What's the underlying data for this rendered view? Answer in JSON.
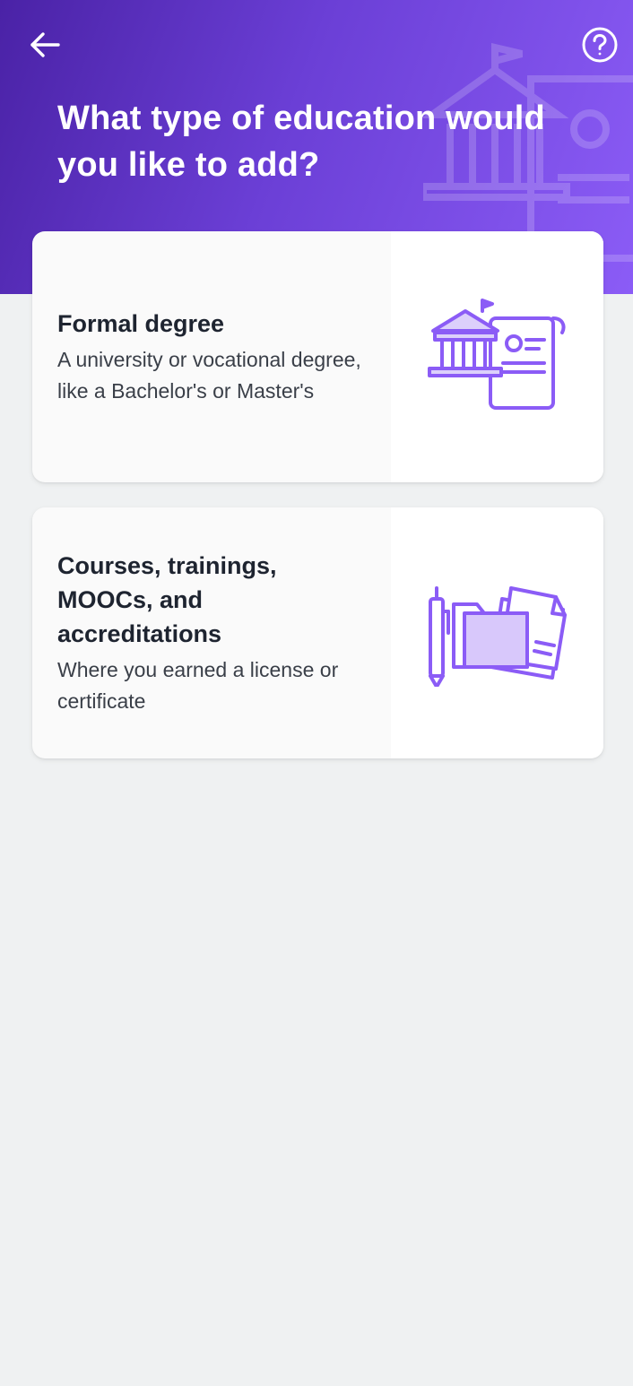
{
  "header": {
    "title": "What type of education would you like to add?",
    "back_icon": "arrow-left-icon",
    "help_icon": "question-circle-icon",
    "background_icon": "university-icon"
  },
  "options": [
    {
      "title": "Formal degree",
      "description": "A university or vocational degree, like a Bachelor's or Master's",
      "icon": "university-diploma-icon"
    },
    {
      "title": "Courses, trainings, MOOCs, and accreditations",
      "description": "Where you earned a license or certificate",
      "icon": "folder-documents-icon"
    }
  ],
  "colors": {
    "header_start": "#4a22a6",
    "header_end": "#8b5cf6",
    "accent": "#8b5cf6",
    "background": "#eff1f2"
  }
}
